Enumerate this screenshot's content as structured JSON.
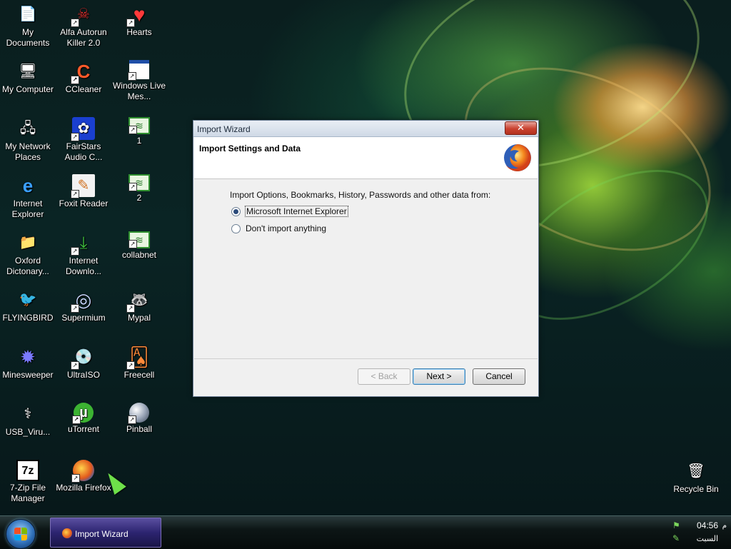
{
  "desktop": {
    "icons": [
      {
        "label": "My Documents",
        "icon": "documents-folder-icon",
        "glyph": "📄"
      },
      {
        "label": "My Computer",
        "icon": "computer-icon",
        "glyph": "🖥"
      },
      {
        "label": "My Network Places",
        "icon": "network-icon",
        "glyph": "🖧"
      },
      {
        "label": "Internet Explorer",
        "icon": "ie-icon",
        "glyph": "e"
      },
      {
        "label": "Oxford Dictonary...",
        "icon": "folder-icon",
        "glyph": "📁"
      },
      {
        "label": "FLYINGBIRD",
        "icon": "bird-icon",
        "glyph": "🐦"
      },
      {
        "label": "Minesweeper",
        "icon": "mine-icon",
        "glyph": "✹"
      },
      {
        "label": "USB_Viru...",
        "icon": "usb-icon",
        "glyph": "⚕"
      },
      {
        "label": "7-Zip File Manager",
        "icon": "7zip-icon",
        "glyph": "7z"
      },
      {
        "label": "Alfa Autorun Killer 2.0",
        "icon": "alfa-icon",
        "glyph": "☠"
      },
      {
        "label": "CCleaner",
        "icon": "ccleaner-icon",
        "glyph": "C"
      },
      {
        "label": "FairStars Audio C...",
        "icon": "fairstars-icon",
        "glyph": "✿"
      },
      {
        "label": "Foxit Reader",
        "icon": "foxit-icon",
        "glyph": "✎"
      },
      {
        "label": "Internet Downlo...",
        "icon": "idm-icon",
        "glyph": "⤓"
      },
      {
        "label": "Supermium",
        "icon": "supermium-icon",
        "glyph": "◎"
      },
      {
        "label": "UltraISO",
        "icon": "ultraiso-icon",
        "glyph": "💿"
      },
      {
        "label": "uTorrent",
        "icon": "utorrent-icon",
        "glyph": "µ"
      },
      {
        "label": "Mozilla Firefox",
        "icon": "firefox-icon",
        "glyph": "🦊"
      },
      {
        "label": "Hearts",
        "icon": "hearts-icon",
        "glyph": "♥"
      },
      {
        "label": "Windows Live Mes...",
        "icon": "window-icon",
        "glyph": "▭"
      },
      {
        "label": "1",
        "icon": "document-icon",
        "glyph": "≋"
      },
      {
        "label": "2",
        "icon": "document-icon",
        "glyph": "≋"
      },
      {
        "label": "collabnet",
        "icon": "document-icon",
        "glyph": "≋"
      },
      {
        "label": "Mypal",
        "icon": "mypal-icon",
        "glyph": "🦝"
      },
      {
        "label": "Freecell",
        "icon": "freecell-icon",
        "glyph": "🂡"
      },
      {
        "label": "Pinball",
        "icon": "pinball-icon",
        "glyph": "●"
      },
      {
        "label": "Recycle Bin",
        "icon": "recycle-bin-icon",
        "glyph": "🗑"
      }
    ]
  },
  "dialog": {
    "title": "Import Wizard",
    "close_glyph": "✕",
    "header": "Import Settings and Data",
    "prompt": "Import Options, Bookmarks, History, Passwords and other data from:",
    "options": [
      {
        "label": "Microsoft Internet Explorer",
        "selected": true
      },
      {
        "label": "Don't import anything",
        "selected": false
      }
    ],
    "buttons": {
      "back": "< Back",
      "next": "Next >",
      "cancel": "Cancel"
    }
  },
  "taskbar": {
    "task": "Import Wizard",
    "clock": "04:56",
    "ampm": "م",
    "date": "السبت"
  }
}
